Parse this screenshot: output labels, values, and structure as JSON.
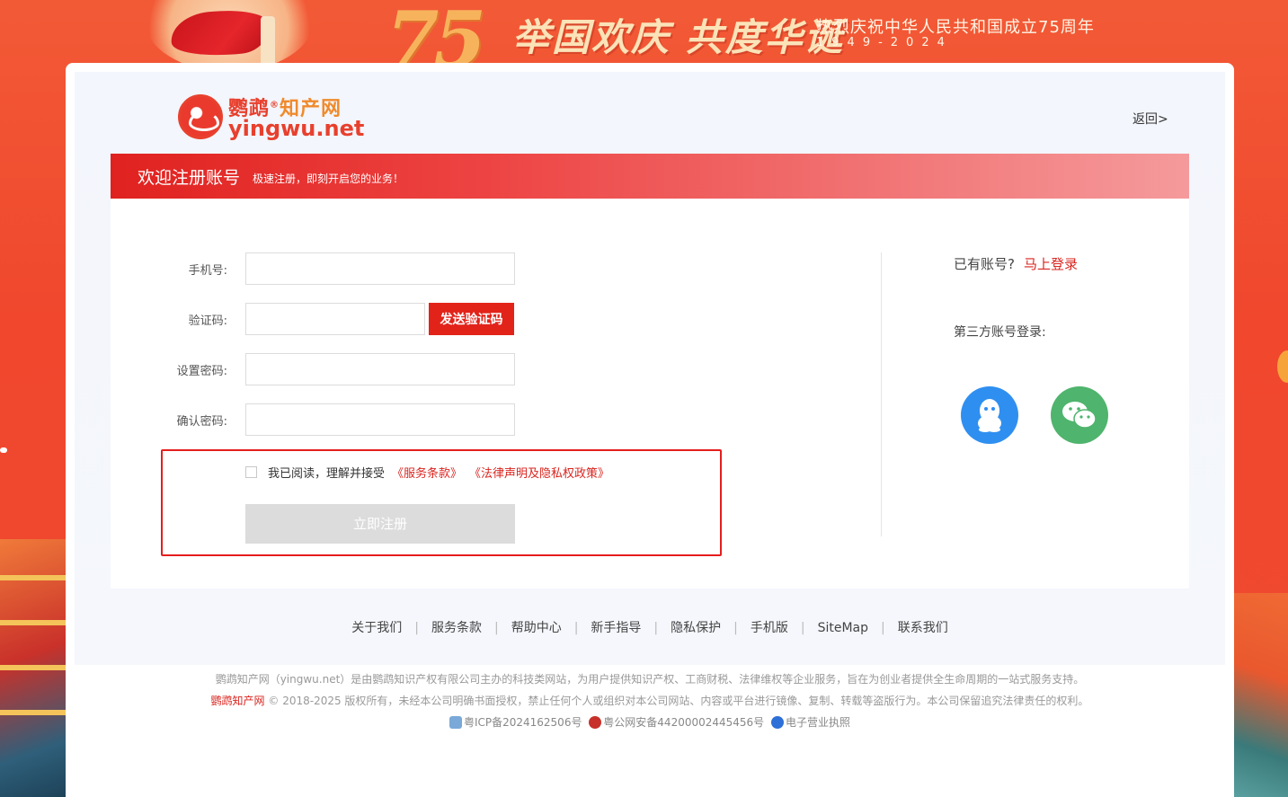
{
  "banner": {
    "number": "75",
    "slogan": "举国欢庆 共度华诞",
    "title": "热烈庆祝中华人民共和国成立75周年",
    "years": "1949-2024"
  },
  "header": {
    "logo_cn_1": "鹦鹉",
    "logo_cn_2": "知产网",
    "logo_reg": "®",
    "logo_en": "yingwu.net",
    "back_label": "返回>"
  },
  "welcome": {
    "title": "欢迎注册账号",
    "subtitle": "极速注册，即刻开启您的业务！"
  },
  "form": {
    "phone_label": "手机号:",
    "code_label": "验证码:",
    "send_code_label": "发送验证码",
    "password_label": "设置密码:",
    "confirm_label": "确认密码:",
    "agree_text": "我已阅读，理解并接受",
    "terms_link": "《服务条款》",
    "privacy_link": "《法律声明及隐私权政策》",
    "register_label": "立即注册",
    "phone_value": "",
    "code_value": "",
    "password_value": "",
    "confirm_value": "",
    "agreed": false
  },
  "side": {
    "have_account": "已有账号?",
    "login_link": "马上登录",
    "third_party": "第三方账号登录:"
  },
  "colors": {
    "brand_red": "#e2231a",
    "qq_blue": "#2f8ff0",
    "wechat_green": "#4fb46d",
    "disabled_gray": "#dcdcdc"
  },
  "footer": {
    "links": [
      "关于我们",
      "服务条款",
      "帮助中心",
      "新手指导",
      "隐私保护",
      "手机版",
      "SiteMap",
      "联系我们"
    ],
    "description": "鹦鹉知产网（yingwu.net）是由鹦鹉知识产权有限公司主办的科技类网站，为用户提供知识产权、工商财税、法律维权等企业服务，旨在为创业者提供全生命周期的一站式服务支持。",
    "copyright_brand": "鹦鹉知产网",
    "copyright_text": "© 2018-2025 版权所有，未经本公司明确书面授权，禁止任何个人或组织对本公司网站、内容或平台进行镜像、复制、转载等盗版行为。本公司保留追究法律责任的权利。",
    "icp": "粤ICP备2024162506号",
    "police": "粤公网安备44200002445456号",
    "license": "电子营业执照"
  }
}
